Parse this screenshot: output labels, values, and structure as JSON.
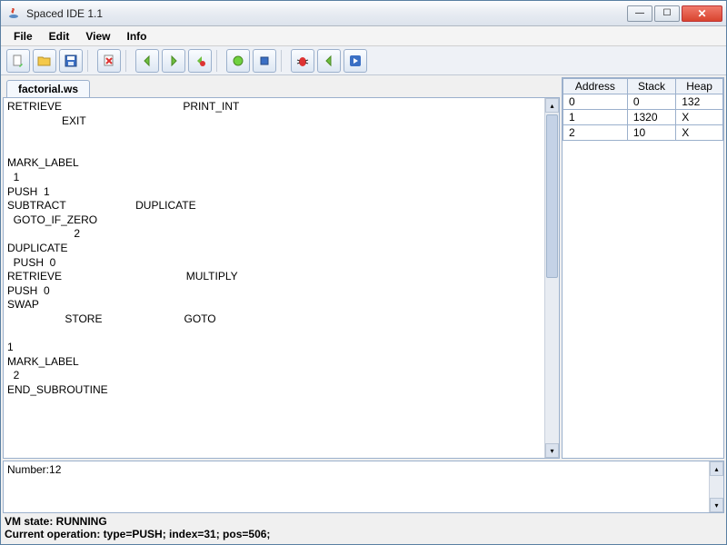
{
  "window": {
    "title": "Spaced IDE 1.1"
  },
  "menu": {
    "file": "File",
    "edit": "Edit",
    "view": "View",
    "info": "Info"
  },
  "tab": {
    "label": "factorial.ws"
  },
  "editor": {
    "content": "RETRIEVE                                        PRINT_INT\n                  EXIT\n\n\nMARK_LABEL\n  1\nPUSH  1\nSUBTRACT                       DUPLICATE\n  GOTO_IF_ZERO\n                      2\nDUPLICATE\n  PUSH  0\nRETRIEVE                                         MULTIPLY\nPUSH  0\nSWAP\n                   STORE                           GOTO\n\n1\nMARK_LABEL\n  2\nEND_SUBROUTINE"
  },
  "memory": {
    "headers": {
      "address": "Address",
      "stack": "Stack",
      "heap": "Heap"
    },
    "rows": [
      {
        "address": "0",
        "stack": "0",
        "heap": "132"
      },
      {
        "address": "1",
        "stack": "1320",
        "heap": "X"
      },
      {
        "address": "2",
        "stack": "10",
        "heap": "X"
      }
    ]
  },
  "console": {
    "output": "Number:12"
  },
  "status": {
    "vm": "VM state: RUNNING",
    "op": "Current operation: type=PUSH; index=31; pos=506;"
  }
}
